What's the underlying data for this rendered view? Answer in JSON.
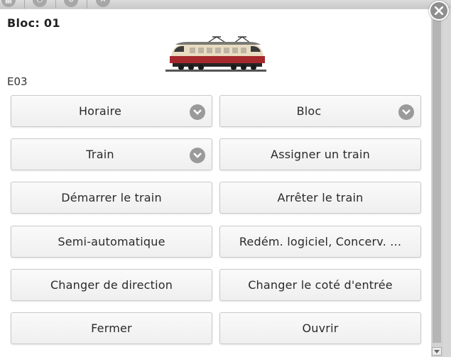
{
  "dialog": {
    "title": "Bloc: 01",
    "subtitle": "E03",
    "image": "locomotive-image"
  },
  "buttons": {
    "horaire": "Horaire",
    "bloc": "Bloc",
    "train": "Train",
    "assign_train": "Assigner un train",
    "start_train": "Démarrer le train",
    "stop_train": "Arrêter le train",
    "semi_auto": "Semi-automatique",
    "restart": "Redém. logiciel, Concerv. ...",
    "change_direction": "Changer de direction",
    "change_entry": "Changer le coté d'entrée",
    "close": "Fermer",
    "open": "Ouvrir"
  },
  "icons": {
    "close": "close-icon",
    "dropdown": "chevron-down-icon",
    "toolbar": [
      "grid-icon",
      "power-icon",
      "refresh-icon",
      "close-icon"
    ]
  },
  "colors": {
    "dialog_bg": "#ffffff",
    "button_bg": "#f5f5f5",
    "icon_gray": "#9a9a9a"
  }
}
